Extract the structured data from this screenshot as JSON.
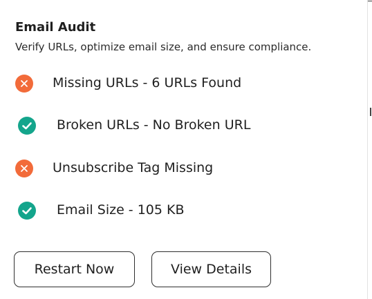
{
  "colors": {
    "fail": "#f26b3a",
    "pass": "#14a58c"
  },
  "audit": {
    "title": "Email Audit",
    "subtitle": "Verify URLs, optimize email size, and ensure compliance.",
    "checks": [
      {
        "label": "Missing URLs - 6 URLs Found",
        "status": "fail",
        "icon": "x-circle-icon"
      },
      {
        "label": "Broken URLs - No Broken URL",
        "status": "pass",
        "icon": "check-circle-icon"
      },
      {
        "label": "Unsubscribe Tag Missing",
        "status": "fail",
        "icon": "x-circle-icon"
      },
      {
        "label": "Email Size - 105 KB",
        "status": "pass",
        "icon": "check-circle-icon"
      }
    ]
  },
  "actions": {
    "restart_label": "Restart Now",
    "details_label": "View Details"
  }
}
